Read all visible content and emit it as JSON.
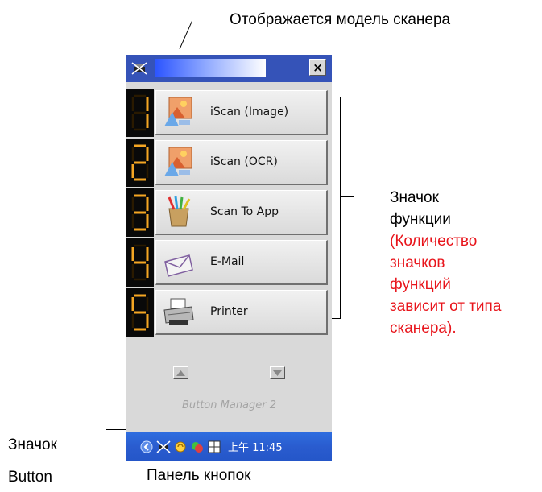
{
  "annotations": {
    "scanner_model": "Отображается модель сканера",
    "function_icon_line1": "Значок",
    "function_icon_line2": "функции",
    "note_lines": [
      "(Количество",
      "значков",
      "функций",
      "зависит от типа",
      "сканера)."
    ],
    "button_icon_line1": "Значок",
    "button_icon_line2": "Button",
    "button_panel": "Панель кнопок"
  },
  "panel": {
    "title": "",
    "close_label": "×",
    "buttons": [
      {
        "number": "1",
        "label": "iScan (Image)",
        "icon": "iscan-image-icon"
      },
      {
        "number": "2",
        "label": "iScan (OCR)",
        "icon": "iscan-ocr-icon"
      },
      {
        "number": "3",
        "label": "Scan To App",
        "icon": "scan-to-app-icon"
      },
      {
        "number": "4",
        "label": "E-Mail",
        "icon": "email-icon"
      },
      {
        "number": "5",
        "label": "Printer",
        "icon": "printer-icon"
      }
    ],
    "scroll_up_icon": "triangle-up-icon",
    "scroll_down_icon": "triangle-down-icon",
    "footer_label": "Button Manager 2"
  },
  "taskbar": {
    "clock": "上午 11:45",
    "tray_icons": [
      "arrow-icon",
      "scanner-icon",
      "volume-icon",
      "network-icon",
      "window-icon"
    ]
  },
  "colors": {
    "note_red": "#e8141b",
    "digit_orange": "#f5a623",
    "title_bar": "#3553b8",
    "taskbar_blue": "#2a5ccf"
  }
}
